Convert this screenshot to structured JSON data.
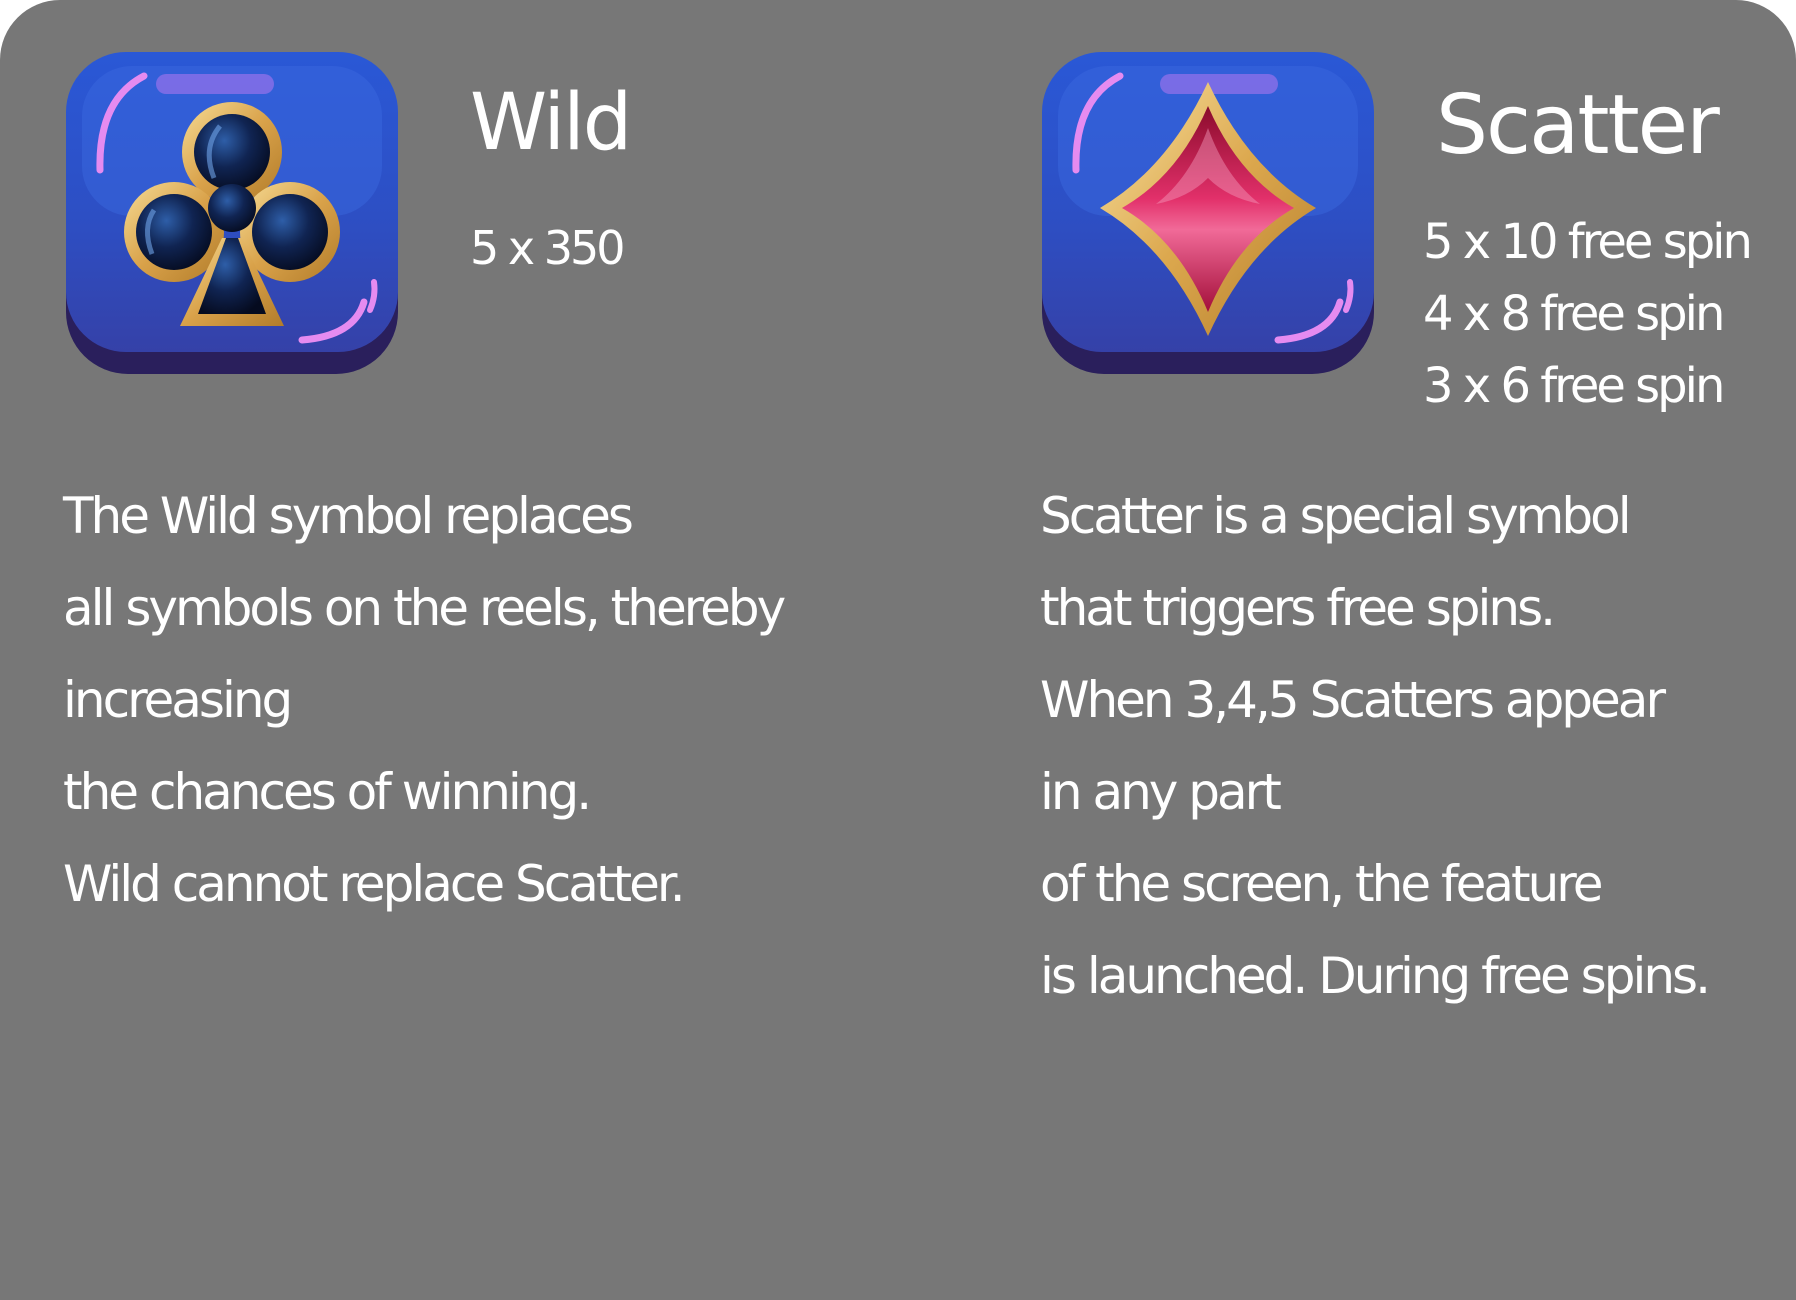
{
  "wild": {
    "icon": "club-icon",
    "title": "Wild",
    "payouts": [
      "5 x 350"
    ],
    "description": [
      "The Wild symbol replaces",
      "all symbols on the reels, thereby",
      "increasing",
      "the chances of winning.",
      "Wild cannot replace Scatter."
    ]
  },
  "scatter": {
    "icon": "diamond-icon",
    "title": "Scatter",
    "payouts": [
      "5 x 10 free spin",
      "4 x 8 free spin",
      "3 x 6 free spin"
    ],
    "description": [
      "Scatter is a special symbol",
      "that triggers free spins.",
      "When 3,4,5 Scatters appear",
      "in any part",
      "of the screen, the feature",
      "is launched. During free spins."
    ]
  },
  "colors": {
    "panel_background": "#777777",
    "text": "#ffffff",
    "tile_blue": "#2d4fc4",
    "tile_shadow": "#2a1f5c",
    "gold": "#e7b75a",
    "club_fill": "#0d1a3e",
    "diamond_fill": "#d0174f"
  }
}
